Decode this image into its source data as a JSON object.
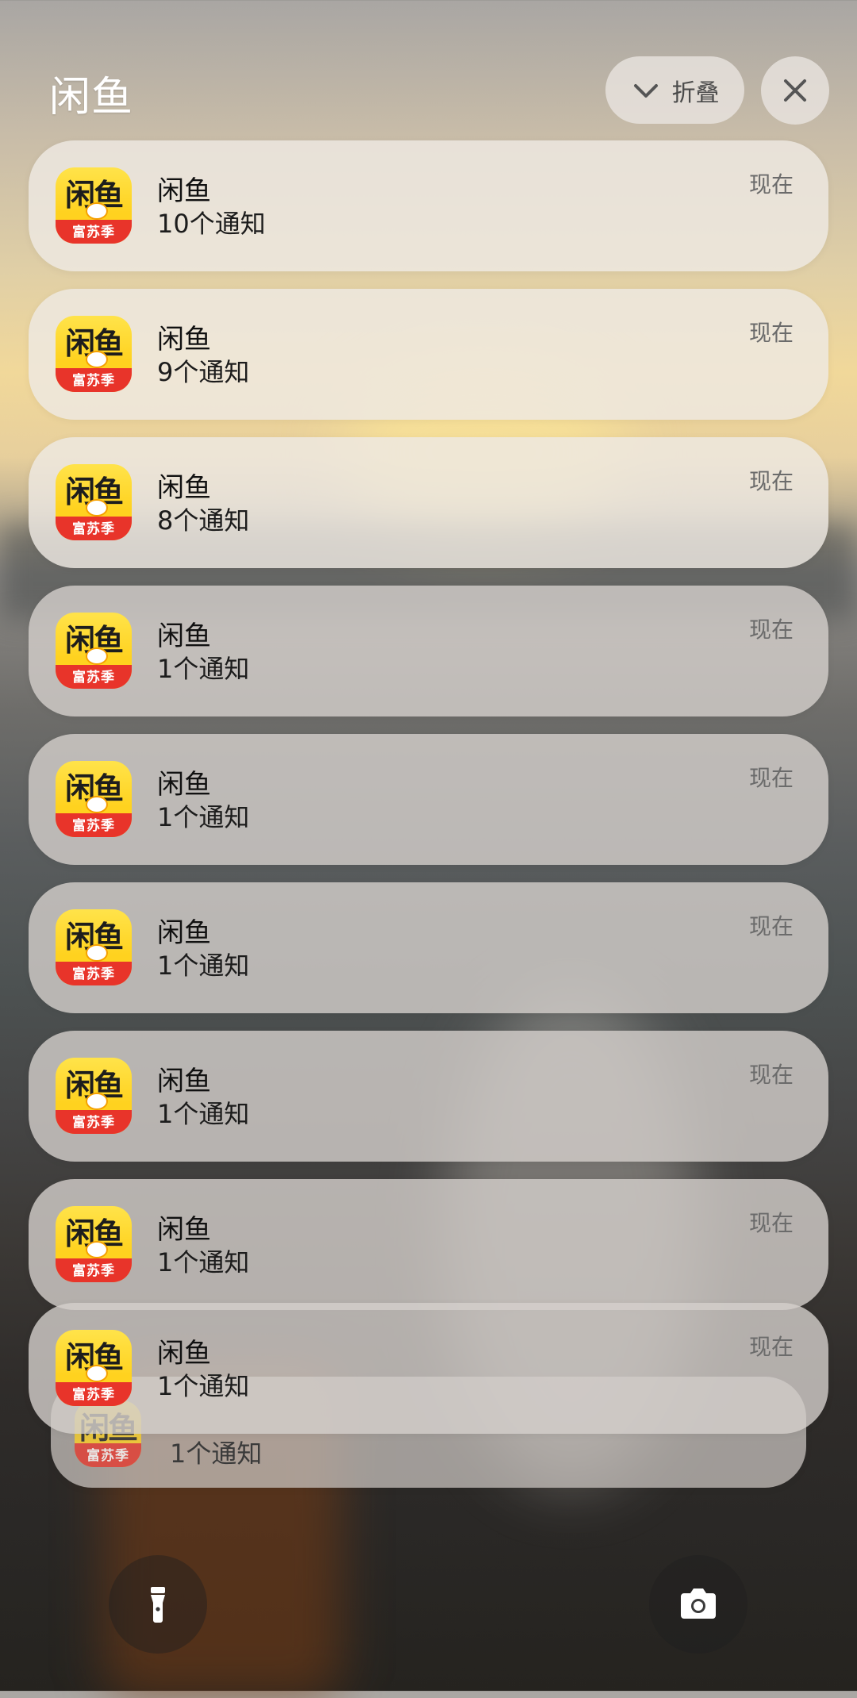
{
  "header": {
    "title": "闲鱼",
    "collapse_label": "折叠"
  },
  "icon_badge": {
    "brand": "闲鱼",
    "band": "富苏季"
  },
  "notifications": [
    {
      "app": "闲鱼",
      "body": "10个通知",
      "time": "现在"
    },
    {
      "app": "闲鱼",
      "body": "9个通知",
      "time": "现在"
    },
    {
      "app": "闲鱼",
      "body": "8个通知",
      "time": "现在"
    },
    {
      "app": "闲鱼",
      "body": "1个通知",
      "time": "现在"
    },
    {
      "app": "闲鱼",
      "body": "1个通知",
      "time": "现在"
    },
    {
      "app": "闲鱼",
      "body": "1个通知",
      "time": "现在"
    },
    {
      "app": "闲鱼",
      "body": "1个通知",
      "time": "现在"
    },
    {
      "app": "闲鱼",
      "body": "1个通知",
      "time": "现在"
    },
    {
      "app": "闲鱼",
      "body": "1个通知",
      "time": "现在"
    }
  ],
  "stacked_card": {
    "body": "1个通知"
  },
  "bottom_actions": {
    "left_icon": "flashlight-icon",
    "right_icon": "camera-icon"
  }
}
